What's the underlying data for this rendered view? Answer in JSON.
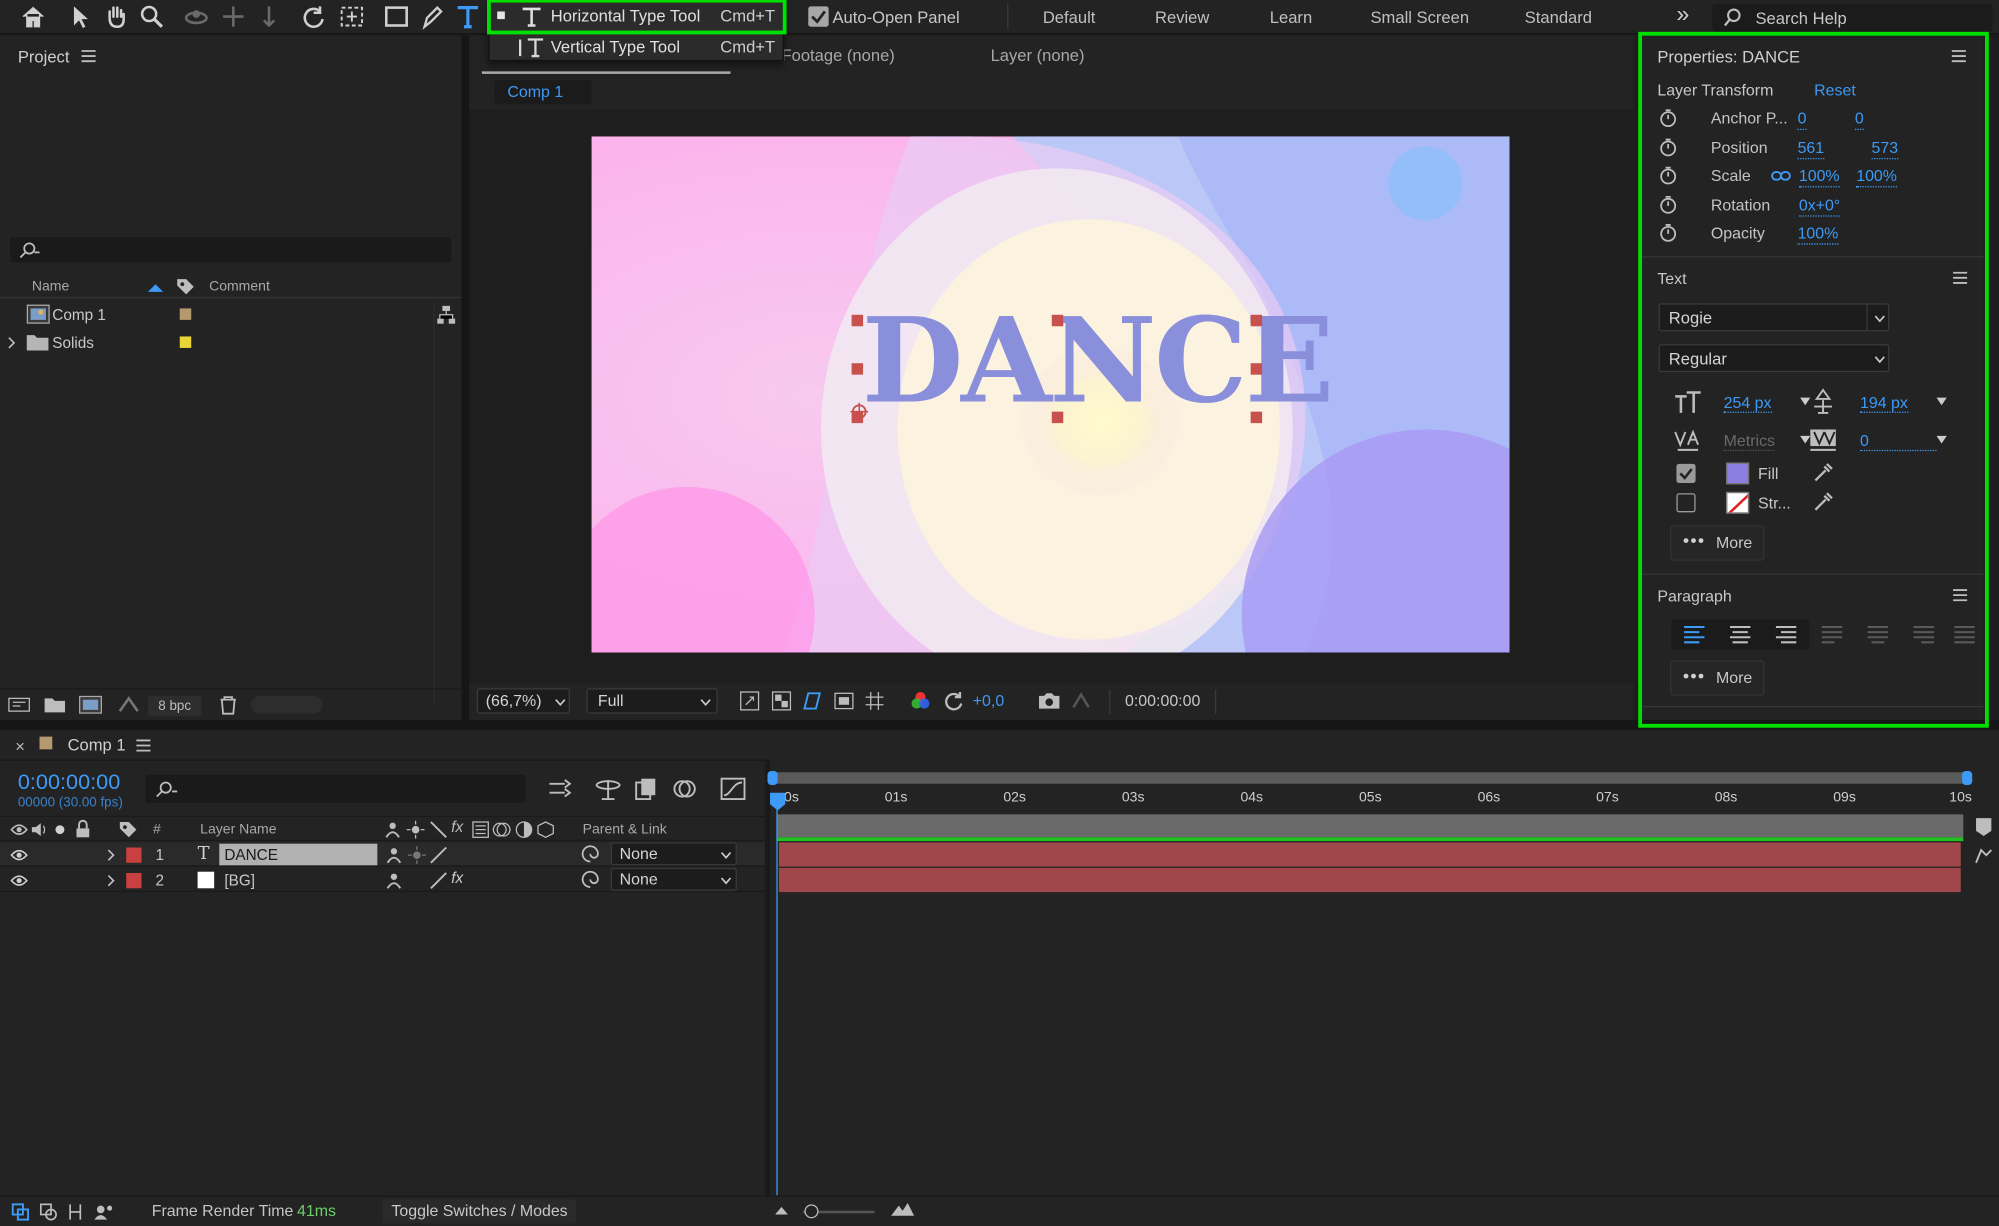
{
  "toolbar": {
    "icons": [
      "home-icon",
      "selection-arrow-icon",
      "hand-icon",
      "zoom-icon",
      "orbit-icon",
      "pan-behind-icon",
      "dolly-icon",
      "rotate-icon",
      "pan-icon",
      "rectangle-icon",
      "pen-icon",
      "type-icon"
    ],
    "auto_open_panel_label": "Auto-Open Panel",
    "auto_open_checked": true,
    "workspaces": [
      "Default",
      "Review",
      "Learn",
      "Small Screen",
      "Standard"
    ],
    "overflow": "»",
    "search_placeholder": "Search Help"
  },
  "tool_dropdown": {
    "items": [
      {
        "label": "Horizontal Type Tool",
        "shortcut": "Cmd+T",
        "selected": true
      },
      {
        "label": "Vertical Type Tool",
        "shortcut": "Cmd+T",
        "selected": false
      }
    ],
    "highlight_color": "#00e000"
  },
  "project": {
    "title": "Project",
    "columns": {
      "name": "Name",
      "comment": "Comment"
    },
    "items": [
      {
        "name": "Comp 1",
        "label_color": "#b49a6e",
        "type": "composition"
      },
      {
        "name": "Solids",
        "label_color": "#e8d639",
        "type": "folder"
      }
    ],
    "bpc": "8 bpc"
  },
  "viewer": {
    "tabs": {
      "footage": "Footage (none)",
      "layer": "Layer (none)"
    },
    "comp_tab": "Comp 1",
    "zoom": "(66,7%)",
    "resolution": "Full",
    "exposure": "+0,0",
    "timecode": "0:00:00:00",
    "canvas_text": "DANCE",
    "text_color": "#8a8fdc"
  },
  "properties": {
    "title": "Properties: DANCE",
    "layer_transform": "Layer Transform",
    "reset": "Reset",
    "rows": [
      {
        "name": "Anchor P...",
        "v1": "0",
        "v2": "0"
      },
      {
        "name": "Position",
        "v1": "561",
        "v2": "573"
      },
      {
        "name": "Scale",
        "v1": "100%",
        "v2": "100%"
      },
      {
        "name": "Rotation",
        "v1": "0x+0°",
        "v2": ""
      },
      {
        "name": "Opacity",
        "v1": "100%",
        "v2": ""
      }
    ],
    "text_section": "Text",
    "font": "Rogie",
    "style": "Regular",
    "font_size": "254 px",
    "leading": "194 px",
    "kerning": "Metrics",
    "tracking": "0",
    "fill_label": "Fill",
    "fill_color": "#8a7ee0",
    "fill_checked": true,
    "stroke_label": "Str...",
    "stroke_checked": false,
    "more": "More",
    "paragraph_section": "Paragraph",
    "highlight_color": "#00e000"
  },
  "timeline": {
    "comp_name": "Comp 1",
    "timecode": "0:00:00:00",
    "frames": "00000 (30.00 fps)",
    "columns": {
      "num": "#",
      "layer_name": "Layer Name",
      "parent": "Parent & Link"
    },
    "layers": [
      {
        "num": "1",
        "name": "DANCE",
        "type_icon": "T",
        "parent": "None",
        "color": "#c94040"
      },
      {
        "num": "2",
        "name": "[BG]",
        "type_icon": "solid",
        "parent": "None",
        "color": "#c94040"
      }
    ],
    "ruler": [
      "0s",
      "01s",
      "02s",
      "03s",
      "04s",
      "05s",
      "06s",
      "07s",
      "08s",
      "09s",
      "10s"
    ],
    "bar_color": "#a0474c"
  },
  "statusbar": {
    "frame_render_label": "Frame Render Time",
    "frame_render_value": "41ms",
    "toggle": "Toggle Switches / Modes"
  }
}
